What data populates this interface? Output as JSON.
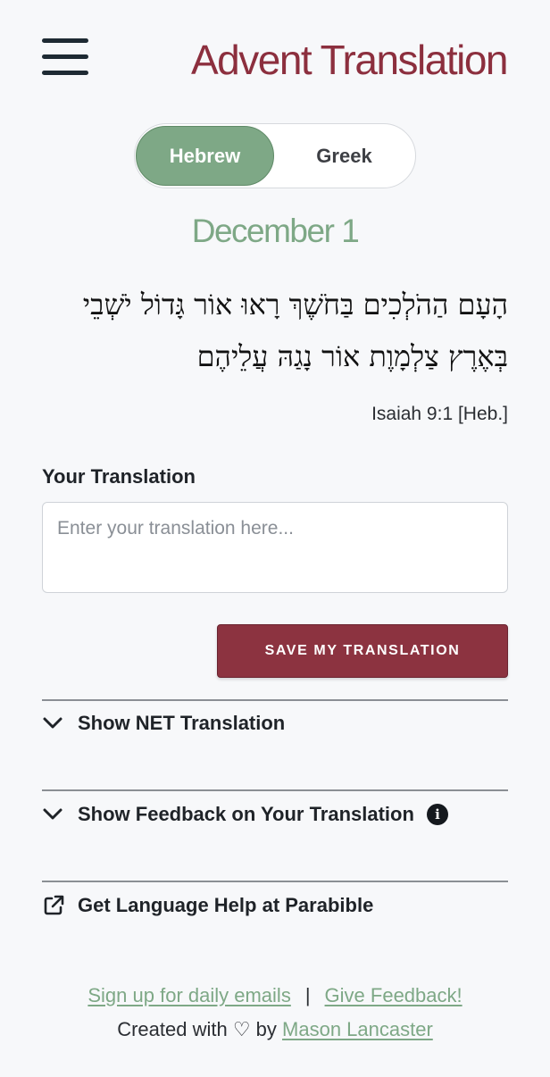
{
  "header": {
    "title": "Advent Translation",
    "menu_icon": "hamburger-menu-icon"
  },
  "language_toggle": {
    "options": [
      "Hebrew",
      "Greek"
    ],
    "selected": "Hebrew"
  },
  "passage": {
    "date": "December 1",
    "text": "הָעָם הַהֹלְכִים בַּחֹשֶׁךְ רָאוּ אוֹר גָּדוֹל יֹשְׁבֵי בְּאֶרֶץ צַלְמָוֶת אוֹר נָגַהּ עֲלֵיהֶם",
    "reference": "Isaiah 9:1 [Heb.]"
  },
  "translation_form": {
    "label": "Your Translation",
    "placeholder": "Enter your translation here...",
    "value": "",
    "save_label": "SAVE MY TRANSLATION"
  },
  "sections": [
    {
      "label": "Show NET Translation",
      "icon": "chevron-down-icon"
    },
    {
      "label": "Show Feedback on Your Translation",
      "icon": "chevron-down-icon",
      "extra_icon": "info-icon"
    },
    {
      "label": "Get Language Help at Parabible",
      "icon": "external-link-icon"
    }
  ],
  "footer": {
    "signup_link": "Sign up for daily emails",
    "separator": "|",
    "feedback_link": "Give Feedback!",
    "created_prefix": "Created with ♡ by",
    "author_link": "Mason Lancaster"
  },
  "colors": {
    "accent_maroon": "#8c2f3e",
    "accent_green": "#7ea886",
    "background": "#f7f8fa"
  }
}
